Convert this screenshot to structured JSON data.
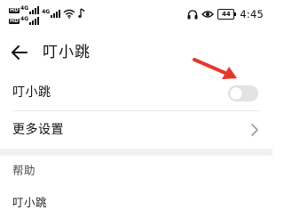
{
  "status_bar": {
    "signal_1_tag": "HD",
    "signal_1_net": "4G",
    "signal_2_tag": "HD",
    "signal_2_net": "4G",
    "signal_3_net": "4G",
    "battery_level": "44",
    "time": "4:45",
    "icons": [
      "signal-icon",
      "wifi-icon",
      "music-note-icon",
      "headset-icon",
      "eye-icon",
      "battery-icon"
    ]
  },
  "header": {
    "title": "叮小跳",
    "back_icon": "back-arrow-icon"
  },
  "settings": {
    "toggle_row_label": "叮小跳",
    "toggle_on": false,
    "more_settings_label": "更多设置"
  },
  "help": {
    "section_title": "帮助",
    "item_label": "叮小跳"
  },
  "annotation": {
    "arrow_color": "#e8372a"
  },
  "colors": {
    "toggle_off_track": "#e3e3e3",
    "divider": "#e9e9e9",
    "section_gap": "#f1f1f1"
  }
}
